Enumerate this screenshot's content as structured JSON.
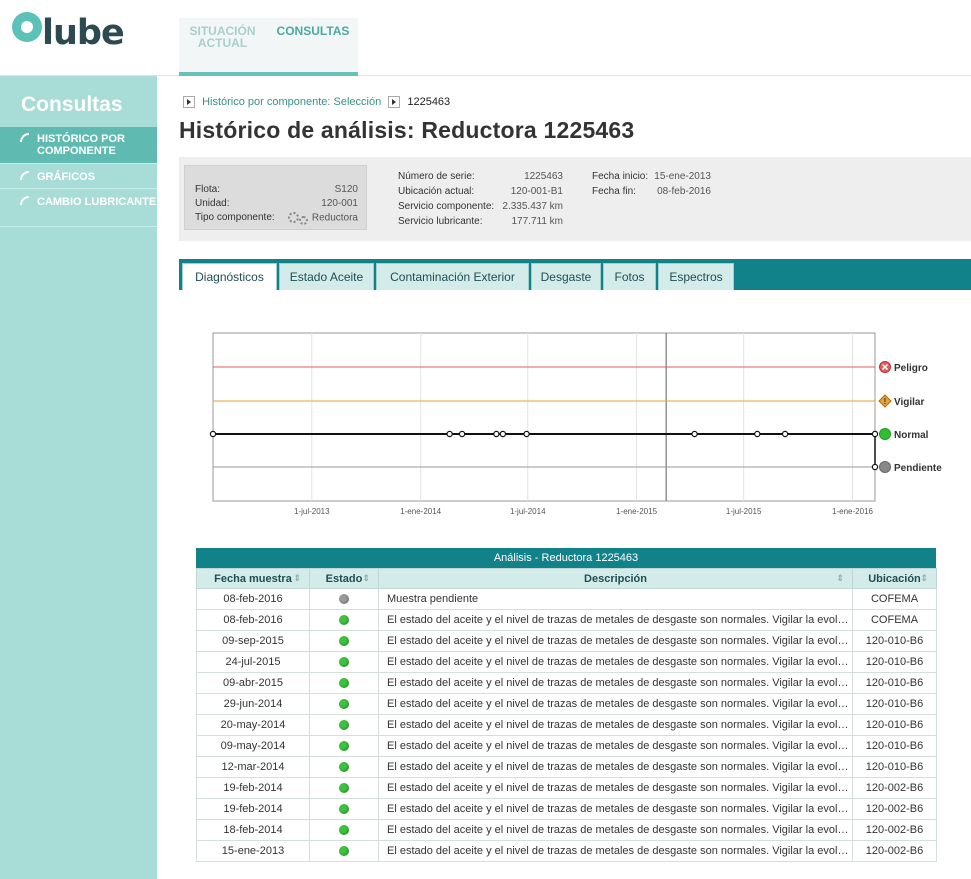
{
  "header": {
    "logo_text": "lube",
    "nav": [
      {
        "label": "SITUACIÓN ACTUAL"
      },
      {
        "label": "CONSULTAS"
      }
    ]
  },
  "sidebar": {
    "title": "Consultas",
    "items": [
      {
        "label": "HISTÓRICO POR COMPONENTE",
        "active": true
      },
      {
        "label": "GRÁFICOS"
      },
      {
        "label": "CAMBIO LUBRICANTE"
      }
    ]
  },
  "breadcrumb": {
    "link": "Histórico por componente: Selección",
    "current": "1225463"
  },
  "page_title": "Histórico de análisis: Reductora 1225463",
  "info": {
    "flota_label": "Flota:",
    "flota_value": "S120",
    "unidad_label": "Unidad:",
    "unidad_value": "120-001",
    "tipo_label": "Tipo componente:",
    "tipo_value": "Reductora",
    "serie_label": "Número de serie:",
    "serie_value": "1225463",
    "ubicacion_label": "Ubicación actual:",
    "ubicacion_value": "120-001-B1",
    "servicio_comp_label": "Servicio componente:",
    "servicio_comp_value": "2.335.437 km",
    "servicio_lub_label": "Servicio lubricante:",
    "servicio_lub_value": "177.711 km",
    "fecha_inicio_label": "Fecha inicio:",
    "fecha_inicio_value": "15-ene-2013",
    "fecha_fin_label": "Fecha fin:",
    "fecha_fin_value": "08-feb-2016"
  },
  "tabs": [
    {
      "label": "Diagnósticos",
      "active": true
    },
    {
      "label": "Estado Aceite"
    },
    {
      "label": "Contaminación Exterior"
    },
    {
      "label": "Desgaste"
    },
    {
      "label": "Fotos"
    },
    {
      "label": "Espectros"
    }
  ],
  "chart_data": {
    "type": "line",
    "x_ticks": [
      "1-jul-2013",
      "1-ene-2014",
      "1-jul-2014",
      "1-ene-2015",
      "1-jul-2015",
      "1-ene-2016"
    ],
    "x_range": [
      "2013-01-15",
      "2016-02-08"
    ],
    "levels": [
      {
        "name": "Peligro",
        "color": "#e35d5d"
      },
      {
        "name": "Vigilar",
        "color": "#e8a33a"
      },
      {
        "name": "Normal",
        "color": "#2fbf2f"
      },
      {
        "name": "Pendiente",
        "color": "#888888"
      }
    ],
    "points": [
      {
        "date": "2013-01-15",
        "level": "Normal"
      },
      {
        "date": "2014-02-19",
        "level": "Normal"
      },
      {
        "date": "2014-03-12",
        "level": "Normal"
      },
      {
        "date": "2014-05-09",
        "level": "Normal"
      },
      {
        "date": "2014-05-20",
        "level": "Normal"
      },
      {
        "date": "2014-06-29",
        "level": "Normal"
      },
      {
        "date": "2015-04-09",
        "level": "Normal"
      },
      {
        "date": "2015-07-24",
        "level": "Normal"
      },
      {
        "date": "2015-09-09",
        "level": "Normal"
      },
      {
        "date": "2016-02-08",
        "level": "Normal"
      },
      {
        "date": "2016-02-08",
        "level": "Pendiente"
      }
    ]
  },
  "table": {
    "caption": "Análisis - Reductora 1225463",
    "headers": [
      "Fecha muestra",
      "Estado",
      "Descripción",
      "Ubicación"
    ],
    "status_colors": {
      "normal": "#3cc23c",
      "pendiente": "#9a9a9a"
    },
    "rows": [
      {
        "fecha": "08-feb-2016",
        "estado": "pendiente",
        "descripcion": "Muestra pendiente",
        "ubicacion": "COFEMA"
      },
      {
        "fecha": "08-feb-2016",
        "estado": "normal",
        "descripcion": "El estado del aceite y el nivel de trazas de metales de desgaste son normales. Vigilar la evolución. .",
        "ubicacion": "COFEMA"
      },
      {
        "fecha": "09-sep-2015",
        "estado": "normal",
        "descripcion": "El estado del aceite y el nivel de trazas de metales de desgaste son normales. Vigilar la evolucion..",
        "ubicacion": "120-010-B6"
      },
      {
        "fecha": "24-jul-2015",
        "estado": "normal",
        "descripcion": "El estado del aceite y el nivel de trazas de metales de desgaste son normales. Vigilar la evolucion..",
        "ubicacion": "120-010-B6"
      },
      {
        "fecha": "09-abr-2015",
        "estado": "normal",
        "descripcion": "El estado del aceite y el nivel de trazas de metales de desgaste son normales. Vigilar la evolucion..",
        "ubicacion": "120-010-B6"
      },
      {
        "fecha": "29-jun-2014",
        "estado": "normal",
        "descripcion": "El estado del aceite y el nivel de trazas de metales de desgaste son normales. Vigilar la evolucion..",
        "ubicacion": "120-010-B6"
      },
      {
        "fecha": "20-may-2014",
        "estado": "normal",
        "descripcion": "El estado del aceite y el nivel de trazas de metales de desgaste son normales. Vigilar la evolucion..",
        "ubicacion": "120-010-B6"
      },
      {
        "fecha": "09-may-2014",
        "estado": "normal",
        "descripcion": "El estado del aceite y el nivel de trazas de metales de desgaste son normales. Vigilar la evolucion..",
        "ubicacion": "120-010-B6"
      },
      {
        "fecha": "12-mar-2014",
        "estado": "normal",
        "descripcion": "El estado del aceite y el nivel de trazas de metales de desgaste son normales. Vigilar la evolucion.",
        "ubicacion": "120-010-B6"
      },
      {
        "fecha": "19-feb-2014",
        "estado": "normal",
        "descripcion": "El estado del aceite y el nivel de trazas de metales de desgaste son normales. Vigilar la evolucion.",
        "ubicacion": "120-002-B6"
      },
      {
        "fecha": "19-feb-2014",
        "estado": "normal",
        "descripcion": "El estado del aceite y el nivel de trazas de metales de desgaste son normales. Vigilar la evolucion.",
        "ubicacion": "120-002-B6"
      },
      {
        "fecha": "18-feb-2014",
        "estado": "normal",
        "descripcion": "El estado del aceite y el nivel de trazas de metales de desgaste son normales. Vigilar la evolucion.",
        "ubicacion": "120-002-B6"
      },
      {
        "fecha": "15-ene-2013",
        "estado": "normal",
        "descripcion": "El estado del aceite y el nivel de trazas de metales de desgaste son normales. Vigilar la evolucion.",
        "ubicacion": "120-002-B6"
      }
    ]
  }
}
